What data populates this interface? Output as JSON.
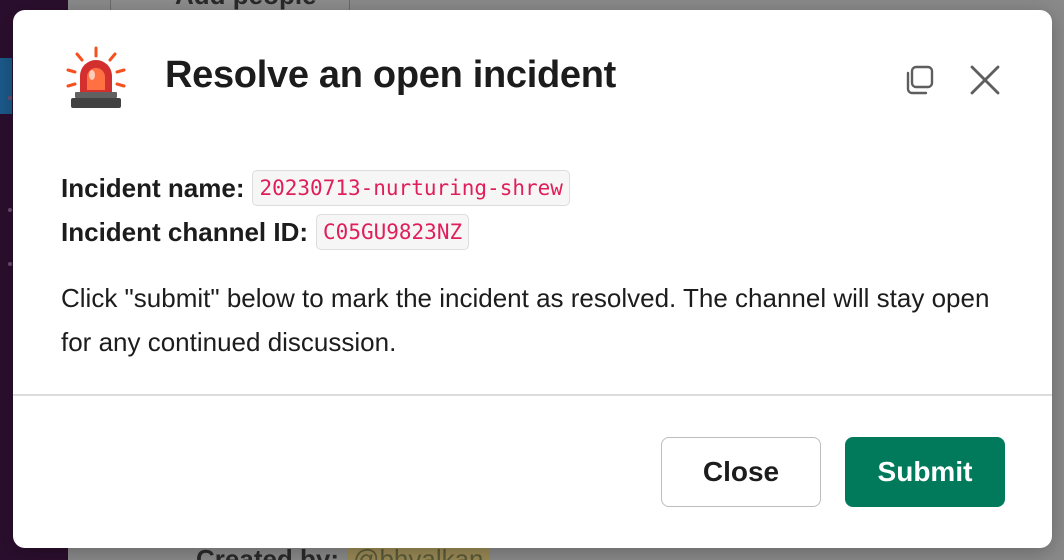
{
  "background": {
    "add_people_label": "Add people",
    "created_by_label": "Created by:",
    "created_by_handle": "@bhyalkan"
  },
  "modal": {
    "title": "Resolve an open incident",
    "header_icon": "rotating-light-emoji",
    "popout_icon": "popout-icon",
    "close_icon": "close-icon",
    "fields": [
      {
        "label": "Incident name:",
        "value": "20230713-nurturing-shrew"
      },
      {
        "label": "Incident channel ID:",
        "value": "C05GU9823NZ"
      }
    ],
    "description": "Click \"submit\" below to mark the incident as resolved. The channel will stay open for any continued discussion.",
    "buttons": {
      "close_label": "Close",
      "submit_label": "Submit"
    }
  },
  "colors": {
    "submit_bg": "#007a5a",
    "code_text": "#e01e5a",
    "title_text": "#1d1c1d"
  }
}
